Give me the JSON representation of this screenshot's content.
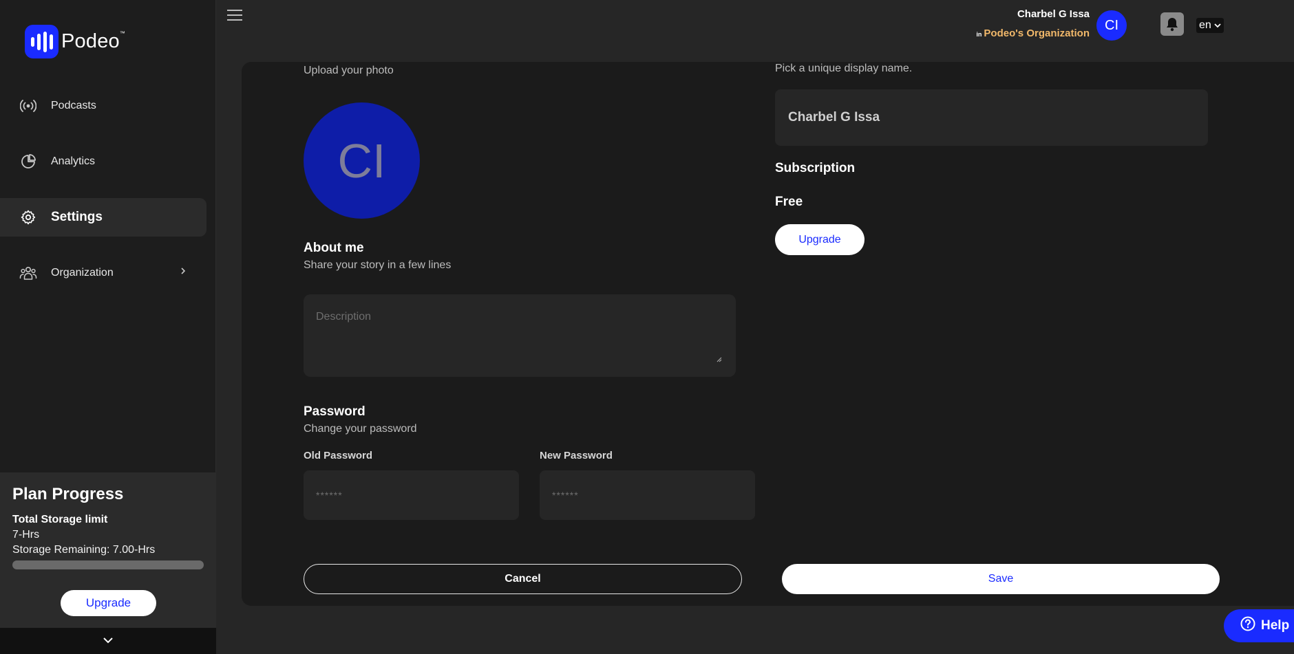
{
  "app": {
    "logo_text": "Podeo",
    "logo_tm": "™"
  },
  "sidebar": {
    "items": [
      {
        "label": "Podcasts",
        "icon": "broadcast-icon"
      },
      {
        "label": "Analytics",
        "icon": "pie-chart-icon"
      },
      {
        "label": "Settings",
        "icon": "gear-icon",
        "active": true
      },
      {
        "label": "Organization",
        "icon": "people-icon",
        "has_submenu": true
      }
    ],
    "plan": {
      "title": "Plan Progress",
      "subtitle": "Total Storage limit",
      "limit": "7-Hrs",
      "remaining": "Storage Remaining: 7.00-Hrs",
      "used_fraction": 0,
      "upgrade_label": "Upgrade"
    }
  },
  "header": {
    "user_name": "Charbel G Issa",
    "org_prefix": "in",
    "org_name": "Podeo's Organization",
    "avatar_initials": "CI",
    "language": "en"
  },
  "profile": {
    "photo_label": "Upload your photo",
    "photo_initials": "CI",
    "about_title": "About me",
    "about_sub": "Share your story in a few lines",
    "description_placeholder": "Description",
    "password_title": "Password",
    "password_sub": "Change your password",
    "old_password_label": "Old Password",
    "new_password_label": "New Password",
    "password_placeholder": "******",
    "cancel_label": "Cancel",
    "save_label": "Save",
    "display_name_label": "Pick a unique display name.",
    "display_name_value": "Charbel G Issa",
    "subscription_title": "Subscription",
    "subscription_plan": "Free",
    "subscription_upgrade": "Upgrade"
  },
  "help": {
    "label": "Help"
  },
  "colors": {
    "accent": "#1a2bff",
    "org": "#f1b86a",
    "panel": "#1b1b1b",
    "bg": "#262626"
  }
}
